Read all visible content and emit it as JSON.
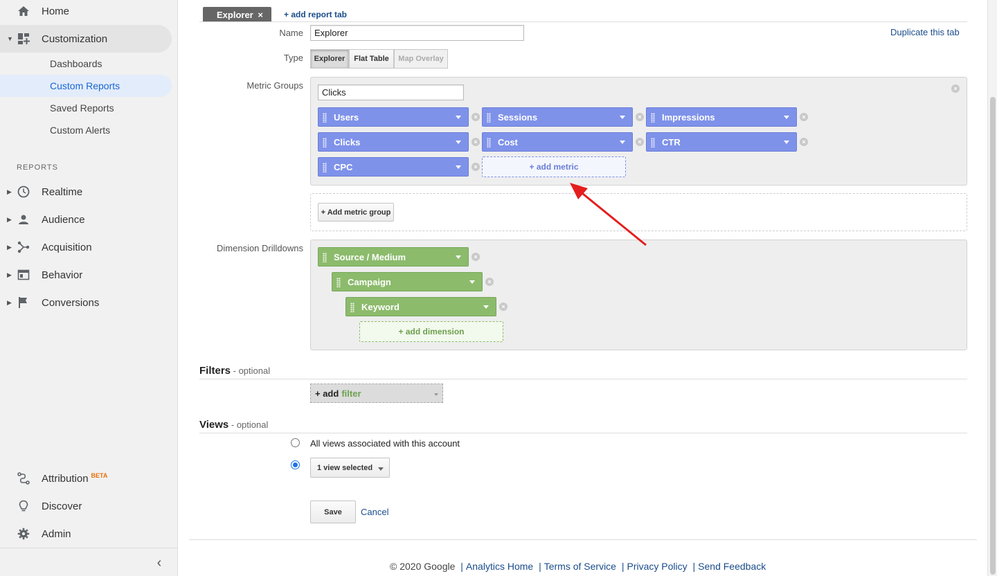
{
  "sidebar": {
    "top_items": [
      {
        "label": "Home",
        "icon": "home-icon"
      },
      {
        "label": "Customization",
        "icon": "dashboard-grid-icon",
        "expanded": true
      }
    ],
    "sub_items": [
      {
        "label": "Dashboards"
      },
      {
        "label": "Custom Reports",
        "selected": true
      },
      {
        "label": "Saved Reports"
      },
      {
        "label": "Custom Alerts"
      }
    ],
    "reports_heading": "REPORTS",
    "report_items": [
      {
        "label": "Realtime",
        "icon": "clock-icon"
      },
      {
        "label": "Audience",
        "icon": "person-icon"
      },
      {
        "label": "Acquisition",
        "icon": "acquisition-icon"
      },
      {
        "label": "Behavior",
        "icon": "behavior-icon"
      },
      {
        "label": "Conversions",
        "icon": "flag-icon"
      }
    ],
    "bottom_items": [
      {
        "label": "Attribution",
        "badge": "BETA",
        "icon": "attribution-icon"
      },
      {
        "label": "Discover",
        "icon": "lightbulb-icon"
      },
      {
        "label": "Admin",
        "icon": "gear-icon"
      }
    ],
    "collapse_glyph": "‹"
  },
  "editor": {
    "tab_name": "Explorer",
    "tab_close": "×",
    "add_report_tab": "+ add report tab",
    "duplicate_tab": "Duplicate this tab",
    "name_label": "Name",
    "name_value": "Explorer",
    "type_label": "Type",
    "types": [
      "Explorer",
      "Flat Table",
      "Map Overlay"
    ],
    "metric_groups_label": "Metric Groups",
    "metric_group_name": "Clicks",
    "metrics": [
      "Users",
      "Sessions",
      "Impressions",
      "Clicks",
      "Cost",
      "CTR",
      "CPC"
    ],
    "add_metric": "+ add metric",
    "add_metric_group": "+ Add metric group",
    "dimension_label": "Dimension Drilldowns",
    "dimensions": [
      "Source / Medium",
      "Campaign",
      "Keyword"
    ],
    "add_dimension": "+ add dimension",
    "filters_title": "Filters",
    "filters_optional": " - optional",
    "add_filter_plus": "+ add",
    "add_filter_word": "filter",
    "views_title": "Views",
    "views_optional": " - optional",
    "views_all": "All views associated with this account",
    "views_selected": "1 view selected",
    "save": "Save",
    "cancel": "Cancel"
  },
  "footer": {
    "copyright": "© 2020 Google",
    "links": [
      "Analytics Home",
      "Terms of Service",
      "Privacy Policy",
      "Send Feedback"
    ]
  },
  "colors": {
    "metric_chip": "#7f92ea",
    "dimension_chip": "#8cbb6c",
    "link": "#1a4c8b",
    "selected_nav": "#1967d2",
    "annotation_arrow": "#e41e1e"
  }
}
